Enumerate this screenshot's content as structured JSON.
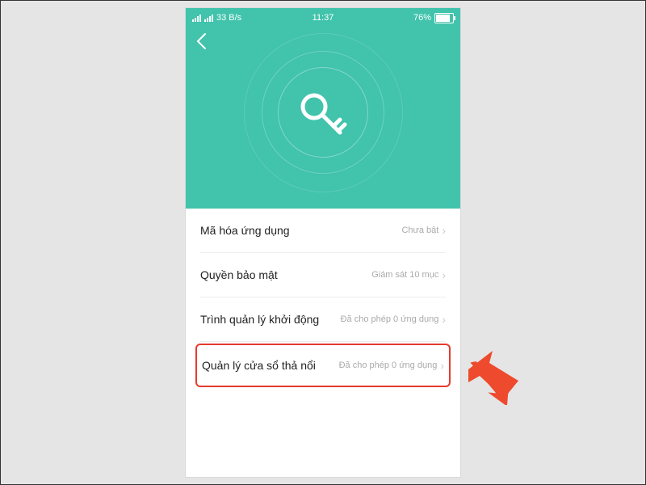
{
  "status": {
    "data_rate": "33 B/s",
    "time": "11:37",
    "battery_pct": "76%"
  },
  "list": {
    "row1": {
      "label": "Mã hóa ứng dụng",
      "value": "Chưa bật"
    },
    "row2": {
      "label": "Quyền bảo mật",
      "value": "Giám sát 10 mục"
    },
    "row3": {
      "label": "Trình quản lý khởi động",
      "value": "Đã cho phép 0 ứng dụng"
    },
    "row4": {
      "label": "Quản lý cửa sổ thả nổi",
      "value": "Đã cho phép 0 ứng dụng"
    }
  },
  "colors": {
    "accent": "#41c3ac",
    "highlight": "#e63b2e",
    "arrow": "#ee4a2e"
  }
}
